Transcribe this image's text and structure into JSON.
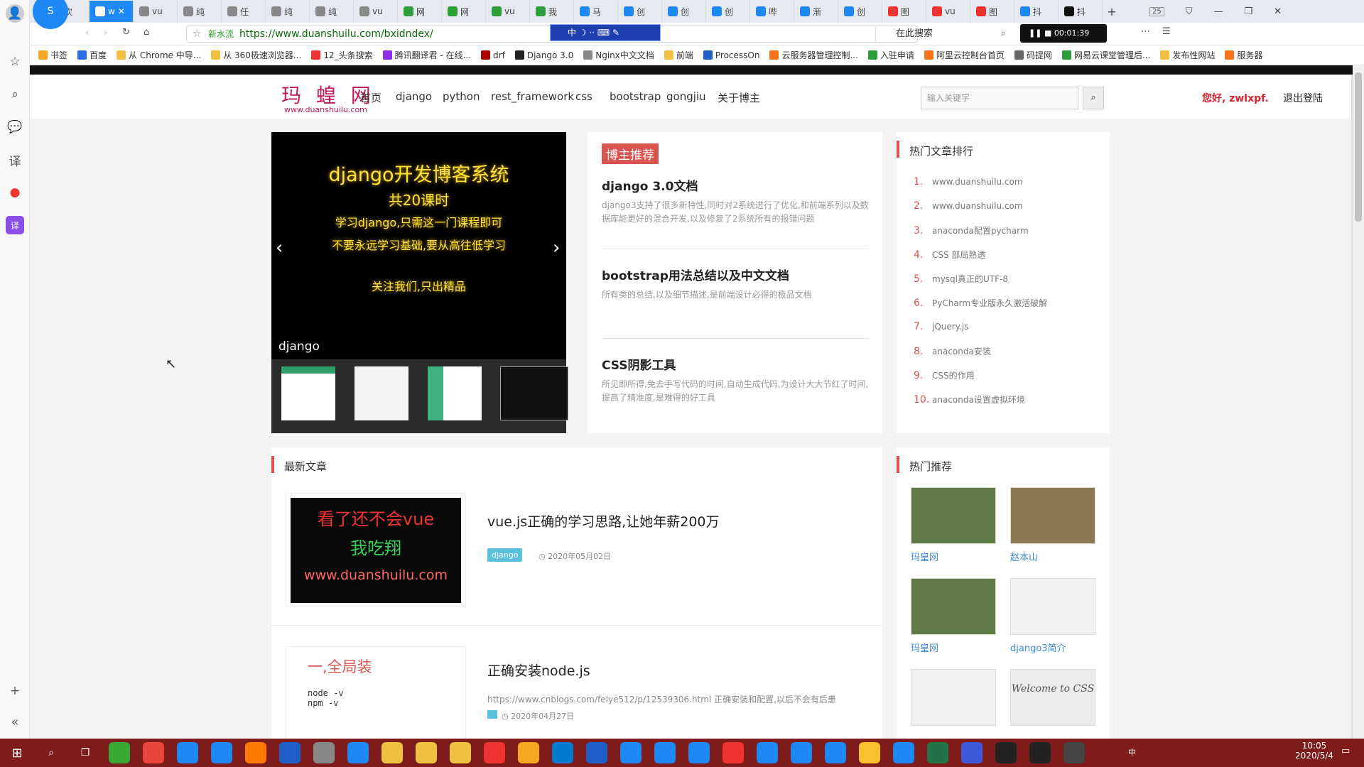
{
  "browser": {
    "tabs": [
      "欢",
      "w",
      "vu",
      "纯",
      "任",
      "纯",
      "纯",
      "vu",
      "网",
      "网",
      "vu",
      "我",
      "马",
      "创",
      "创",
      "创",
      "哔",
      "渐",
      "创",
      "图",
      "vu",
      "图",
      "抖",
      "抖"
    ],
    "new_tab": "+",
    "tab_count": "25",
    "url_prefix": "新水流",
    "url": "https://www.duanshuilu.com/bxidndex/",
    "search_placeholder": "在此搜索",
    "ime_bar": "中",
    "recording_time": "00:01:39",
    "bookmarks": [
      "书签",
      "百度",
      "从 Chrome 中导...",
      "从 360极速浏览器...",
      "12_头条搜索",
      "腾讯翻译君 - 在线...",
      "drf",
      "Django 3.0",
      "Nginx中文文档",
      "前端",
      "ProcessOn",
      "云服务器管理控制...",
      "入驻申请",
      "阿里云控制台首页",
      "码提网",
      "网易云课堂管理后...",
      "发布性网站",
      "服务器"
    ]
  },
  "site": {
    "logo": "玛 蝗 网",
    "logo_sub": "www.duanshuilu.com",
    "nav": [
      "首页",
      "django",
      "python",
      "rest_framework",
      "css",
      "bootstrap",
      "gongjiu",
      "关于博主"
    ],
    "search_placeholder": "输入关键字",
    "greeting": "您好, zwlxpf.",
    "logout": "退出登陆"
  },
  "carousel": {
    "lines": [
      "django开发博客系统",
      "共20课时",
      "学习django,只需这一门课程即可",
      "不要永远学习基础,要从高往低学习",
      "关注我们,只出精品"
    ],
    "caption": "django",
    "prev": "‹",
    "next": "›"
  },
  "recommend": {
    "badge": "博主推荐",
    "items": [
      {
        "title": "django 3.0文档",
        "desc": "django3支持了很多新特性,同时对2系统进行了优化,和前端系列以及数据库能更好的混合开发,以及修复了2系统所有的报错问题"
      },
      {
        "title": "bootstrap用法总结以及中文文档",
        "desc": "所有类的总结,以及细节描述,是前端设计必得的极品文档"
      },
      {
        "title": "CSS阴影工具",
        "desc": "所见即所得,免去手写代码的时间,自动生成代码,为设计大大节红了时间,提高了精准度,是难得的好工具"
      }
    ]
  },
  "hot_articles": {
    "title": "热门文章排行",
    "items": [
      "www.duanshuilu.com",
      "www.duanshuilu.com",
      "anaconda配置pycharm",
      "CSS 部局熟透",
      "mysql真正的UTF-8",
      "PyCharm专业版永久激活破解",
      "jQuery.js",
      "anaconda安装",
      "CSS的作用",
      "anaconda设置虚拟环境"
    ]
  },
  "latest": {
    "title": "最新文章",
    "articles": [
      {
        "thumb_lines": [
          "看了还不会vue",
          "我吃翔",
          "www.duanshuilu.com"
        ],
        "title": "vue.js正确的学习思路,让她年薪200万",
        "tag": "django",
        "date": "2020年05月02日"
      },
      {
        "thumb_lines": [
          "一,全局装",
          "node -v",
          "npm -v"
        ],
        "title": "正确安装node.js",
        "desc": "https://www.cnblogs.com/feiye512/p/12539306.html 正确安装和配置,以后不会有后患",
        "date": "2020年04月27日"
      }
    ]
  },
  "hot_recommend": {
    "title": "热门推荐",
    "items": [
      "玛皇网",
      "赵本山",
      "玛皇网",
      "django3简介",
      "",
      "Welcome to CSS"
    ]
  },
  "taskbar": {
    "time": "10:05",
    "date": "2020/5/4",
    "ime": "中"
  }
}
